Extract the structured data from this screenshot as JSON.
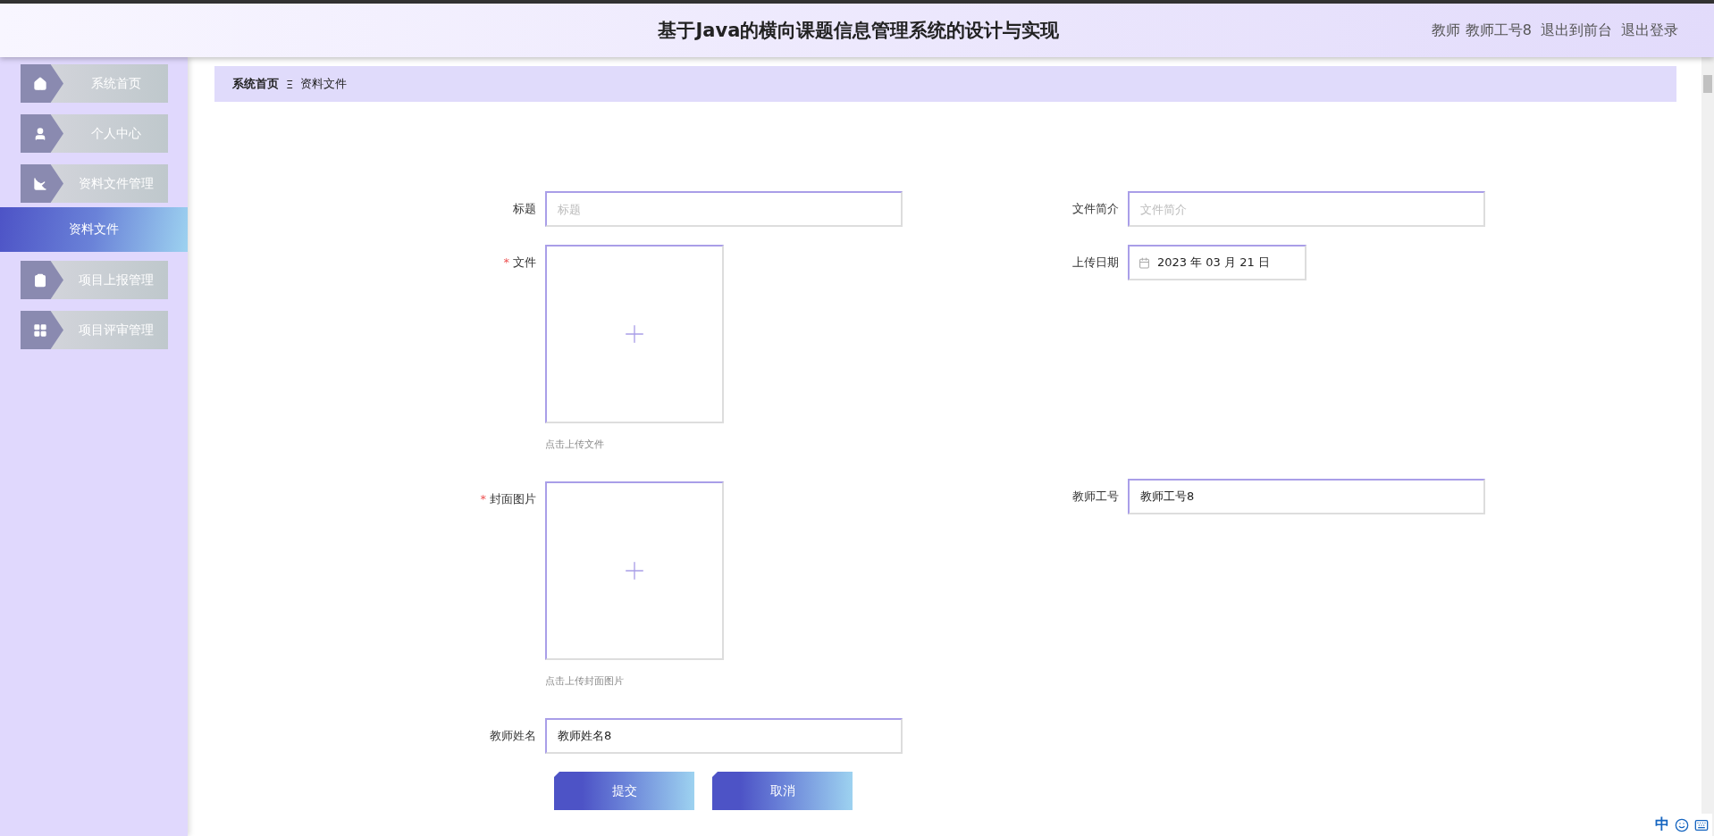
{
  "header": {
    "title": "基于Java的横向课题信息管理系统的设计与实现",
    "user_role": "教师",
    "user_name": "教师工号8",
    "links": [
      "退出到前台",
      "退出登录"
    ]
  },
  "sidebar": {
    "items": [
      {
        "label": "系统首页",
        "selected": false,
        "kind": "menu"
      },
      {
        "label": "个人中心",
        "selected": false,
        "kind": "menu"
      },
      {
        "label": "资料文件管理",
        "selected": false,
        "kind": "menu"
      },
      {
        "label": "资料文件",
        "selected": true,
        "kind": "sub"
      },
      {
        "label": "项目上报管理",
        "selected": false,
        "kind": "menu"
      },
      {
        "label": "项目评审管理",
        "selected": false,
        "kind": "menu"
      }
    ]
  },
  "breadcrumb": {
    "items": [
      "系统首页",
      "资料文件"
    ],
    "separator": "Ξ"
  },
  "form": {
    "left": [
      {
        "kind": "text",
        "label": "标题",
        "placeholder": "标题"
      },
      {
        "kind": "upload",
        "label": "文件",
        "hint": "点击上传文件",
        "required_mark": "*"
      },
      {
        "kind": "upload",
        "label": "封面图片",
        "hint": "点击上传封面图片",
        "required_mark": "*"
      },
      {
        "kind": "text",
        "label": "教师姓名",
        "value": "教师姓名8"
      }
    ],
    "right": [
      {
        "kind": "text",
        "label": "文件简介",
        "placeholder": "文件简介"
      },
      {
        "kind": "date",
        "label": "上传日期",
        "value": "2023 年 03 月 21 日"
      },
      {
        "kind": "spacer"
      },
      {
        "kind": "text",
        "label": "教师工号",
        "value": "教师工号8"
      }
    ],
    "buttons": [
      "提交",
      "取消"
    ]
  },
  "ime": {
    "label": "中"
  }
}
